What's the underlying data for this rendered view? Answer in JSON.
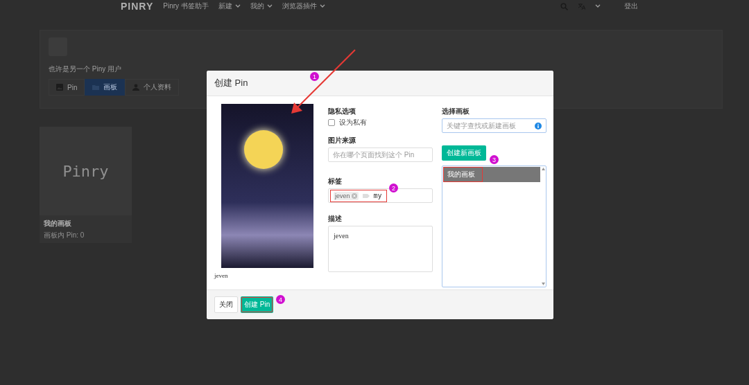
{
  "navbar": {
    "logo": "PINRY",
    "items": [
      {
        "label": "Pinry 书签助手",
        "dropdown": false
      },
      {
        "label": "新建",
        "dropdown": true
      },
      {
        "label": "我的",
        "dropdown": true
      },
      {
        "label": "浏览器插件",
        "dropdown": true
      }
    ],
    "logout": "登出"
  },
  "profile": {
    "username": "也许是另一个 Piny 用户",
    "tabs": [
      {
        "label": "Pin",
        "kind": "image",
        "selected": false
      },
      {
        "label": "画板",
        "kind": "boards",
        "selected": true
      },
      {
        "label": "个人资料",
        "kind": "person",
        "selected": false
      }
    ]
  },
  "boards": [
    {
      "cover_text": "Pinry",
      "title": "我的画板",
      "meta": "画板内 Pin: 0"
    }
  ],
  "modal": {
    "title": "创建 Pin",
    "image_caption": "jeven",
    "privacy": {
      "label": "隐私选项",
      "option": "设为私有",
      "checked": false
    },
    "source": {
      "label": "图片来源",
      "placeholder": "你在哪个页面找到这个 Pin"
    },
    "tags": {
      "label": "标签",
      "items": [
        "jeven"
      ],
      "value": "my"
    },
    "description": {
      "label": "描述",
      "value": "jeven"
    },
    "board": {
      "label": "选择画板",
      "placeholder": "关键字查找或新建画板",
      "create_button": "创建新画板",
      "options": [
        {
          "label": "我的画板",
          "selected": true
        }
      ]
    },
    "buttons": {
      "close": "关闭",
      "submit": "创建 Pin"
    }
  },
  "annotations": [
    {
      "number": "1"
    },
    {
      "number": "2"
    },
    {
      "number": "3"
    },
    {
      "number": "4"
    }
  ]
}
